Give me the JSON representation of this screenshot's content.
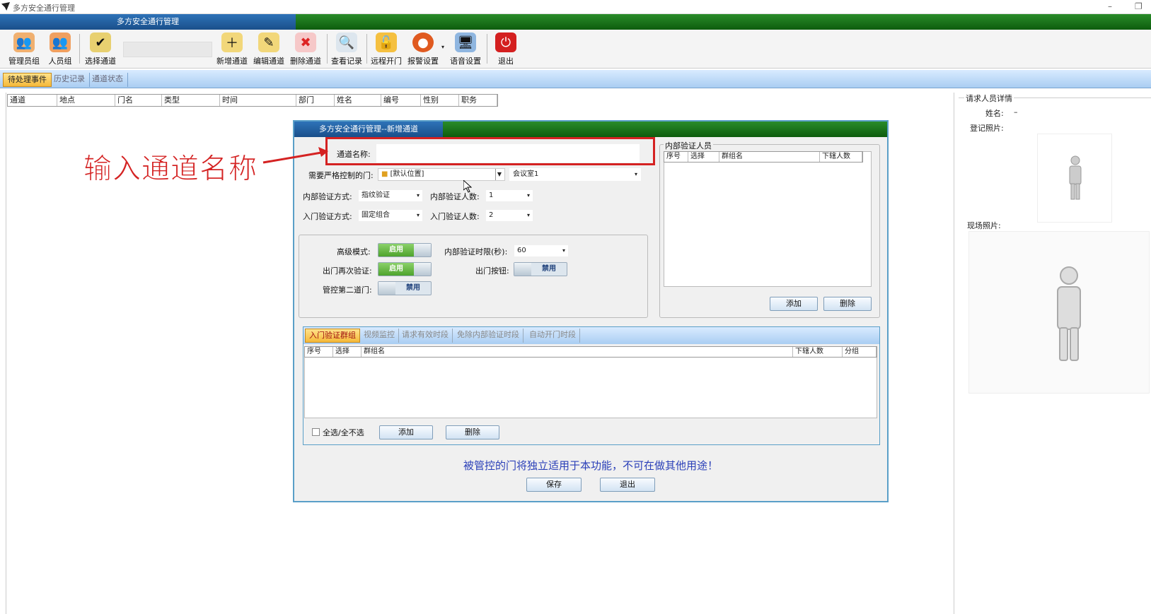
{
  "window": {
    "title": "多方安全通行管理",
    "minimize": "–",
    "restore": "❐"
  },
  "banner": {
    "title": "多方安全通行管理"
  },
  "toolbar": {
    "items": [
      {
        "label": "管理员组",
        "icon": "admin-group-icon"
      },
      {
        "label": "人员组",
        "icon": "people-group-icon"
      },
      {
        "label": "选择通道",
        "icon": "select-channel-icon"
      },
      {
        "label": "新增通道",
        "icon": "add-channel-icon"
      },
      {
        "label": "编辑通道",
        "icon": "edit-channel-icon"
      },
      {
        "label": "删除通道",
        "icon": "delete-channel-icon"
      },
      {
        "label": "查看记录",
        "icon": "view-record-icon"
      },
      {
        "label": "远程开门",
        "icon": "remote-open-icon"
      },
      {
        "label": "报警设置",
        "icon": "alarm-icon"
      },
      {
        "label": "语音设置",
        "icon": "voice-icon"
      },
      {
        "label": "退出",
        "icon": "power-icon"
      }
    ]
  },
  "tabs": [
    "待处理事件",
    "历史记录",
    "通道状态"
  ],
  "event_table": {
    "columns": [
      "通道",
      "地点",
      "门名",
      "类型",
      "时间",
      "部门",
      "姓名",
      "编号",
      "性别",
      "职务"
    ]
  },
  "right_panel": {
    "title": "请求人员详情",
    "name_label": "姓名:",
    "name_value": "–",
    "reg_photo_label": "登记照片:",
    "live_photo_label": "现场照片:"
  },
  "annotation": {
    "text": "输入通道名称"
  },
  "dialog": {
    "title": "多方安全通行管理--新增通道",
    "channel_name_label": "通道名称:",
    "channel_name_value": "",
    "strict_door_label": "需要严格控制的门:",
    "strict_door_value": "[默认位置]",
    "room_value": "会议室1",
    "inner_verify_label": "内部验证方式:",
    "inner_verify_value": "指纹验证",
    "inner_count_label": "内部验证人数:",
    "inner_count_value": "1",
    "entry_verify_label": "入门验证方式:",
    "entry_verify_value": "固定组合",
    "entry_count_label": "入门验证人数:",
    "entry_count_value": "2",
    "advanced_label": "高级模式:",
    "advanced_state": "启用",
    "inner_time_label": "内部验证时限(秒):",
    "inner_time_value": "60",
    "exit_reverify_label": "出门再次验证:",
    "exit_reverify_state": "启用",
    "exit_button_label": "出门按钮:",
    "exit_button_state": "禁用",
    "second_door_label": "管控第二道门:",
    "second_door_state": "禁用",
    "inner_staff": {
      "title": "内部验证人员",
      "columns": [
        "序号",
        "选择",
        "群组名",
        "下辖人数"
      ],
      "add": "添加",
      "delete": "删除"
    },
    "bottom_tabs": [
      "入门验证群组",
      "视频监控",
      "请求有效时段",
      "免除内部验证时段",
      "自动开门时段"
    ],
    "group_table": {
      "columns": [
        "序号",
        "选择",
        "群组名",
        "下辖人数",
        "分组"
      ]
    },
    "select_all_label": "全选/全不选",
    "add": "添加",
    "delete": "删除",
    "notice": "被管控的门将独立适用于本功能，不可在做其他用途！",
    "save": "保存",
    "exit": "退出"
  }
}
